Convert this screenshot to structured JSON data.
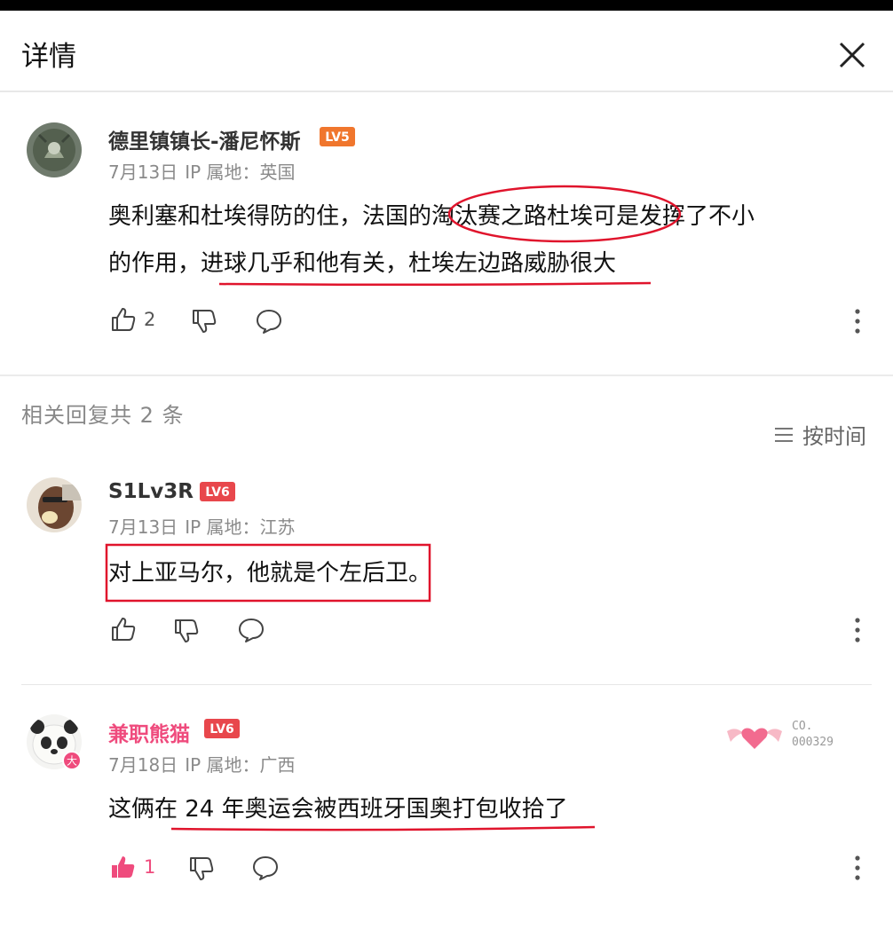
{
  "header": {
    "title": "详情"
  },
  "main_comment": {
    "username": "德里镇镇长-潘尼怀斯",
    "level": "LV5",
    "date": "7月13日",
    "ip": "IP 属地：英国",
    "text_line1": "奥利塞和杜埃得防的住，法国的淘汰赛之路杜埃可是发挥了不小",
    "text_line2": "的作用，进球几乎和他有关，杜埃左边路威胁很大",
    "likes": "2"
  },
  "replies": {
    "title": "相关回复共 2 条",
    "sort_label": "按时间",
    "items": [
      {
        "username": "S1Lv3R",
        "level": "LV6",
        "date": "7月13日",
        "ip": "IP 属地：江苏",
        "text": "对上亚马尔，他就是个左后卫。",
        "likes": ""
      },
      {
        "username": "兼职熊猫",
        "level": "LV6",
        "date": "7月18日",
        "ip": "IP 属地：广西",
        "text": "这俩在 24 年奥运会被西班牙国奥打包收拾了",
        "likes": "1",
        "badge_line1": "CO.",
        "badge_line2": "000329",
        "avatar_badge": "大"
      }
    ]
  },
  "colors": {
    "accent_pink": "#ef4b7d",
    "level5": "#f0762d",
    "level6": "#e8474c",
    "annotation_red": "#e0142c"
  }
}
